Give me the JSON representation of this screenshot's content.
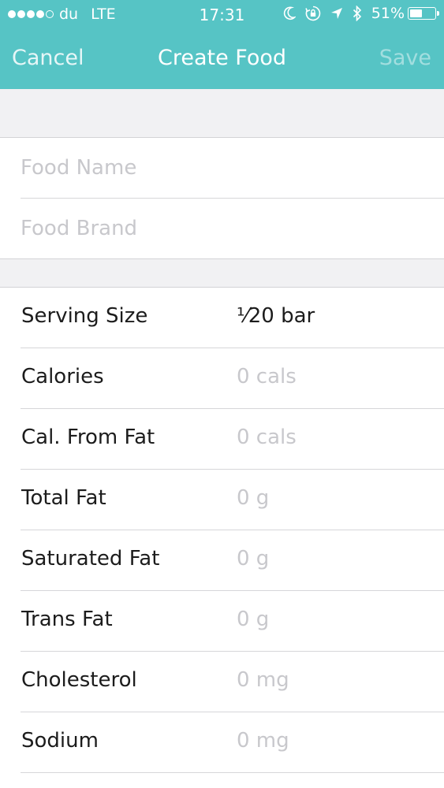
{
  "status_bar": {
    "carrier": "du",
    "network": "LTE",
    "time": "17:31",
    "battery_percent": "51%",
    "battery_level": 0.51,
    "signal_bars_filled": 4,
    "signal_bars_total": 5,
    "icons": [
      "moon-icon",
      "rotation-lock-icon",
      "location-arrow-icon",
      "bluetooth-icon",
      "battery-icon"
    ]
  },
  "nav": {
    "cancel_label": "Cancel",
    "title": "Create Food",
    "save_label": "Save"
  },
  "fields": {
    "food_name_placeholder": "Food Name",
    "food_brand_placeholder": "Food Brand"
  },
  "nutrients": [
    {
      "label": "Serving Size",
      "value": "⅟20 bar",
      "filled": true
    },
    {
      "label": "Calories",
      "value": "0 cals",
      "filled": false
    },
    {
      "label": "Cal. From Fat",
      "value": "0 cals",
      "filled": false
    },
    {
      "label": "Total Fat",
      "value": "0 g",
      "filled": false
    },
    {
      "label": "Saturated Fat",
      "value": "0 g",
      "filled": false
    },
    {
      "label": "Trans Fat",
      "value": "0 g",
      "filled": false
    },
    {
      "label": "Cholesterol",
      "value": "0 mg",
      "filled": false
    },
    {
      "label": "Sodium",
      "value": "0 mg",
      "filled": false
    }
  ],
  "colors": {
    "header": "#56c4c5",
    "section_background": "#f1f1f3",
    "placeholder_text": "#c8c8cc",
    "primary_text": "#1c1c1c"
  }
}
